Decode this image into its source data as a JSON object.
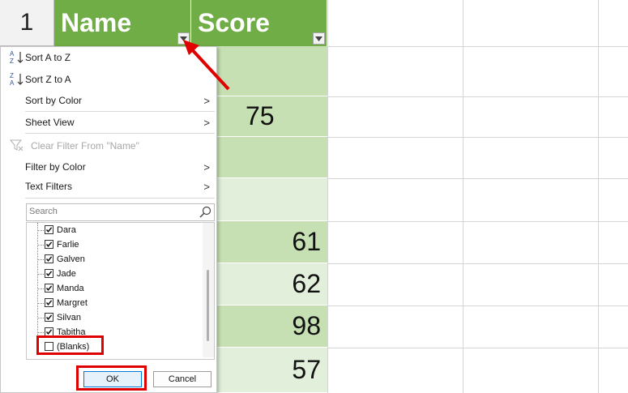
{
  "row_number": "1",
  "headers": {
    "name": "Name",
    "score": "Score"
  },
  "score_cells": [
    "",
    "75",
    "",
    "",
    "61",
    "62",
    "98",
    "57"
  ],
  "menu": {
    "sort_az": "Sort A to Z",
    "sort_za": "Sort Z to A",
    "sort_by_color": "Sort by Color",
    "sheet_view": "Sheet View",
    "clear_filter": "Clear Filter From \"Name\"",
    "filter_by_color": "Filter by Color",
    "text_filters": "Text Filters",
    "search_placeholder": "Search",
    "items": [
      {
        "label": "Dara",
        "checked": true
      },
      {
        "label": "Farlie",
        "checked": true
      },
      {
        "label": "Galven",
        "checked": true
      },
      {
        "label": "Jade",
        "checked": true
      },
      {
        "label": "Manda",
        "checked": true
      },
      {
        "label": "Margret",
        "checked": true
      },
      {
        "label": "Silvan",
        "checked": true
      },
      {
        "label": "Tabitha",
        "checked": true
      },
      {
        "label": "(Blanks)",
        "checked": false
      }
    ],
    "ok": "OK",
    "cancel": "Cancel"
  },
  "colors": {
    "header_green": "#70ad47",
    "dark_green": "#c6e0b4",
    "light_green": "#e2efda",
    "highlight_red": "#e00000"
  }
}
